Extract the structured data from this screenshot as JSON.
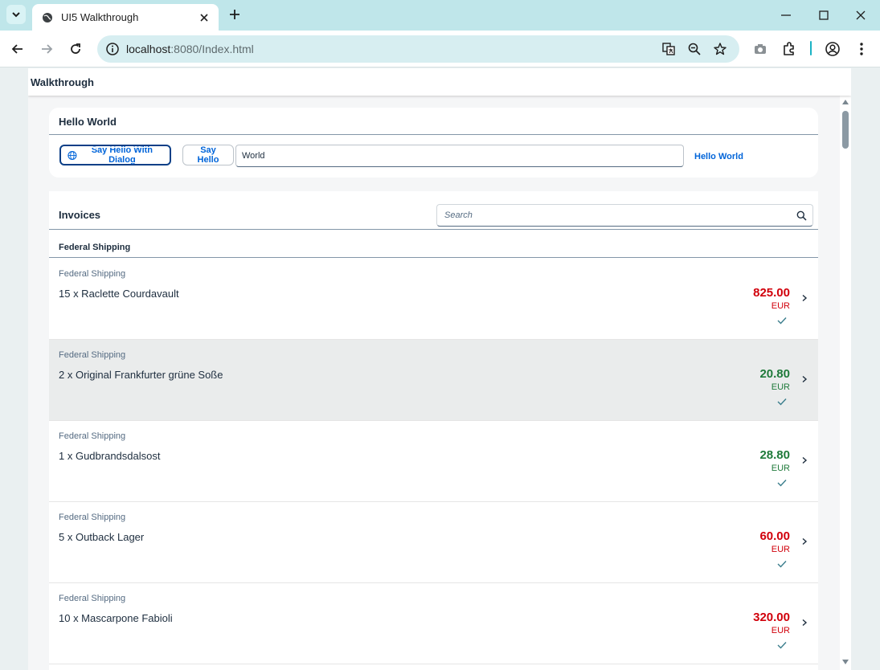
{
  "browser": {
    "tab_title": "UI5 Walkthrough",
    "url_host": "localhost",
    "url_rest": ":8080/Index.html",
    "accent": "#1bb3c4"
  },
  "shell": {
    "title": "Walkthrough"
  },
  "hello_panel": {
    "title": "Hello World",
    "dialog_button": "Say Hello With Dialog",
    "hello_button": "Say Hello",
    "name_value": "World",
    "greeting": "Hello World"
  },
  "invoices": {
    "title": "Invoices",
    "search_placeholder": "Search",
    "group_header": "Federal Shipping",
    "items": [
      {
        "shipper": "Federal Shipping",
        "product": "15 x Raclette Courdavault",
        "amount": "825.00",
        "currency": "EUR",
        "state": "negative"
      },
      {
        "shipper": "Federal Shipping",
        "product": "2 x Original Frankfurter grüne Soße",
        "amount": "20.80",
        "currency": "EUR",
        "state": "positive"
      },
      {
        "shipper": "Federal Shipping",
        "product": "1 x Gudbrandsdalsost",
        "amount": "28.80",
        "currency": "EUR",
        "state": "positive"
      },
      {
        "shipper": "Federal Shipping",
        "product": "5 x Outback Lager",
        "amount": "60.00",
        "currency": "EUR",
        "state": "negative"
      },
      {
        "shipper": "Federal Shipping",
        "product": "10 x Mascarpone Fabioli",
        "amount": "320.00",
        "currency": "EUR",
        "state": "negative"
      }
    ]
  },
  "colors": {
    "negative": "#d1000b",
    "positive": "#1f7a3a",
    "link": "#0064d9"
  }
}
